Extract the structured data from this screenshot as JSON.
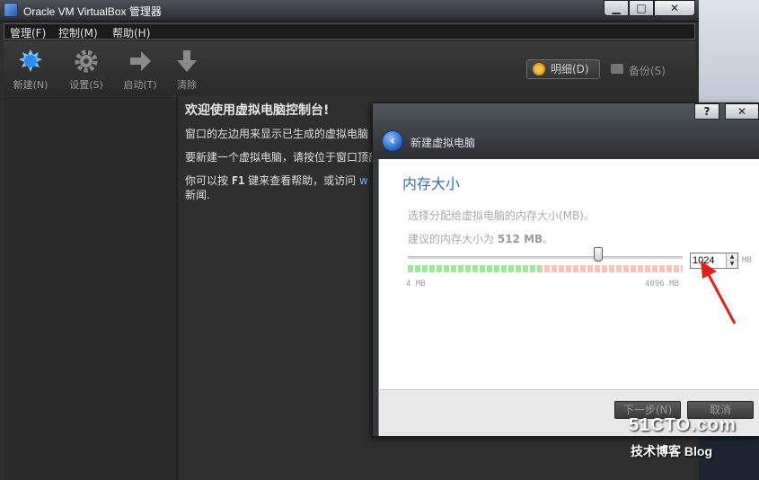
{
  "window": {
    "title": "Oracle VM VirtualBox 管理器",
    "controls": {
      "minimize": "▁",
      "maximize": "□",
      "close": "✕"
    }
  },
  "menu": {
    "items": [
      "管理(F)",
      "控制(M)",
      "帮助(H)"
    ]
  },
  "toolbar": {
    "tools": [
      {
        "label": "新建(N)",
        "icon": "new-icon"
      },
      {
        "label": "设置(S)",
        "icon": "gear-icon"
      },
      {
        "label": "启动(T)",
        "icon": "start-arrow-icon"
      },
      {
        "label": "清除",
        "icon": "discard-arrow-icon"
      }
    ],
    "details_label": "明细(D)",
    "snapshots_label": "备份(S)"
  },
  "welcome": {
    "title": "欢迎使用虚拟电脑控制台!",
    "line1": "窗口的左边用来显示已生成的虚拟电脑",
    "line2": "要新建一个虚拟电脑，请按位于窗口顶部",
    "line3_a": "你可以按",
    "line3_key": "F1",
    "line3_b": "键来查看帮助，或访问",
    "line3_link": "w",
    "line4": "新闻."
  },
  "wizard": {
    "caption": "新建虚拟电脑",
    "help_button": "?",
    "close_button": "✕",
    "back_icon": "back-arrow-icon",
    "page_title": "内存大小",
    "description": "选择分配给虚拟电脑的内存大小(MB)。",
    "recommend_prefix": "建议的内存大小为",
    "recommend_value": "512 MB",
    "recommend_suffix": "。",
    "memory": {
      "value": "1024",
      "min_label": "4 MB",
      "max_label": "4096 MB",
      "unit": "MB",
      "min": 4,
      "max": 4096,
      "current": 1024
    },
    "next_button": "下一步(N)",
    "cancel_button": "取消"
  },
  "watermark": {
    "site": "51CTO.com",
    "tagline": "技术博客 Blog"
  },
  "colors": {
    "accent": "#3b6fa3",
    "annotation_arrow": "#e0201f",
    "slider_green": "#9fe59a",
    "slider_red": "#f6c3bd"
  }
}
